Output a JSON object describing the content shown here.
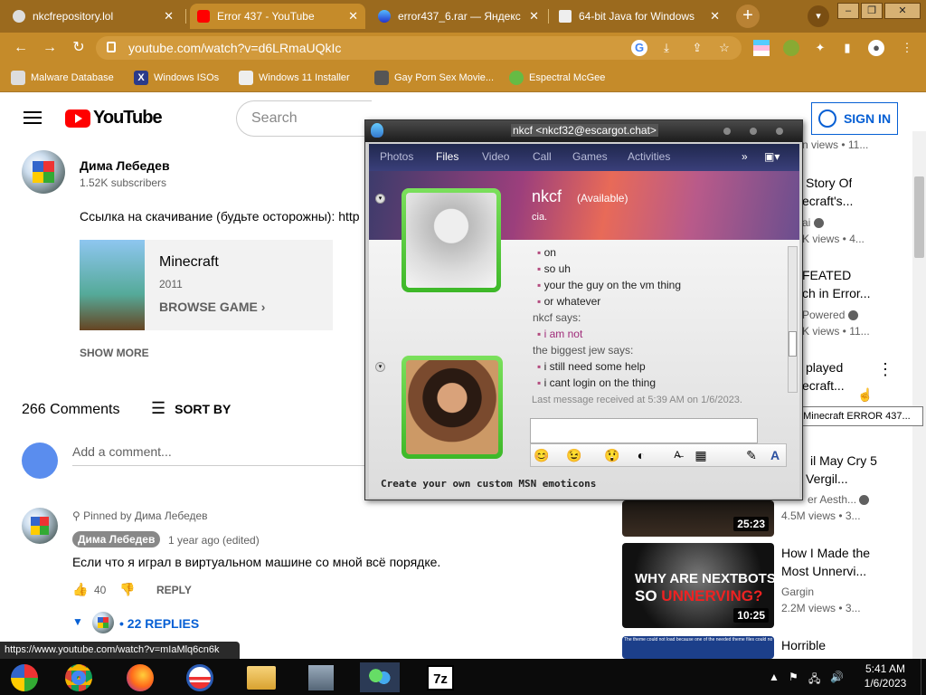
{
  "browser": {
    "tabs": [
      {
        "title": "nkcfrepository.lol",
        "active": false
      },
      {
        "title": "Error 437 - YouTube",
        "active": true
      },
      {
        "title": "error437_6.rar — Яндекс",
        "active": false
      },
      {
        "title": "64-bit Java for Windows",
        "active": false
      }
    ],
    "url": "youtube.com/watch?v=d6LRmaUQkIc",
    "bookmarks": [
      "Malware Database",
      "Windows ISOs",
      "Windows 11 Installer",
      "Gay Porn Sex Movie...",
      "Espectral McGee"
    ],
    "status_url": "https://www.youtube.com/watch?v=mIaMlq6cn6k"
  },
  "youtube": {
    "logo": "YouTube",
    "search_placeholder": "Search",
    "sign_in": "SIGN IN",
    "channel": {
      "name": "Дима Лебедев",
      "subscribers": "1.52K subscribers"
    },
    "description": "Ссылка на скачивание (будьте осторожны): http",
    "game": {
      "title": "Minecraft",
      "year": "2011",
      "browse": "BROWSE GAME"
    },
    "show_more": "SHOW MORE",
    "comments_count": "266 Comments",
    "sort_by": "SORT BY",
    "add_comment": "Add a comment...",
    "pinned_comment": {
      "pinned_by": "Pinned by Дима Лебедев",
      "author": "Дима Лебедев",
      "time": "1 year ago (edited)",
      "text": "Если что я играл в виртуальном машине со мной всё порядке.",
      "likes": "40",
      "reply": "REPLY",
      "replies": "• 22 REPLIES"
    },
    "sidebar": [
      {
        "title1": "",
        "title2": "",
        "channel": "",
        "meta": "n views • 11..."
      },
      {
        "title1": "Story Of",
        "title2": "ecraft's...",
        "channel": "ai",
        "meta": "K views • 4..."
      },
      {
        "title1": "FEATED",
        "title2": "ch in Error...",
        "channel": "Powered",
        "meta": "K views • 11..."
      },
      {
        "title1": "played",
        "title2": "ecraft...",
        "channel": "",
        "meta": ""
      },
      {
        "title1": "il May Cry 5",
        "title2": "Vergil...",
        "channel": "er Aesth...",
        "meta": "4.5M views • 3...",
        "duration": "25:23"
      },
      {
        "title1": "How I Made the",
        "title2": "Most Unnervi...",
        "channel": "Gargin",
        "meta": "2.2M views • 3...",
        "duration": "10:25",
        "thumb_text1": "WHY ARE NEXTBOTS",
        "thumb_text2a": "SO ",
        "thumb_text2b": "UNNERVING?"
      },
      {
        "title1": "Horrible",
        "title2": "",
        "channel": "",
        "meta": "",
        "thumb_text": "The theme could not load because one of the needed theme files could not be found"
      }
    ],
    "tooltip": "So I played Minecraft ERROR 437..."
  },
  "msn": {
    "title": "nkcf <nkcf32@escargot.chat>",
    "nav": [
      "Photos",
      "Files",
      "Video",
      "Call",
      "Games",
      "Activities"
    ],
    "contact_name": "nkcf",
    "contact_status": "(Available)",
    "contact_message": "cia.",
    "messages": [
      {
        "type": "bullet",
        "text": "on"
      },
      {
        "type": "bullet",
        "text": "so uh"
      },
      {
        "type": "bullet",
        "text": "your the guy on the vm thing"
      },
      {
        "type": "bullet",
        "text": "or whatever"
      },
      {
        "type": "says",
        "text": "nkcf says:"
      },
      {
        "type": "bullet-pink",
        "text": "i am not"
      },
      {
        "type": "says",
        "text": "the biggest jew says:"
      },
      {
        "type": "bullet",
        "text": "i still need some help"
      },
      {
        "type": "bullet",
        "text": "i cant login on the thing"
      }
    ],
    "last_message": "Last message received at 5:39 AM on 1/6/2023.",
    "promo": "Create your own custom MSN emoticons"
  },
  "taskbar": {
    "time": "5:41 AM",
    "date": "1/6/2023",
    "app_7z": "7z"
  }
}
